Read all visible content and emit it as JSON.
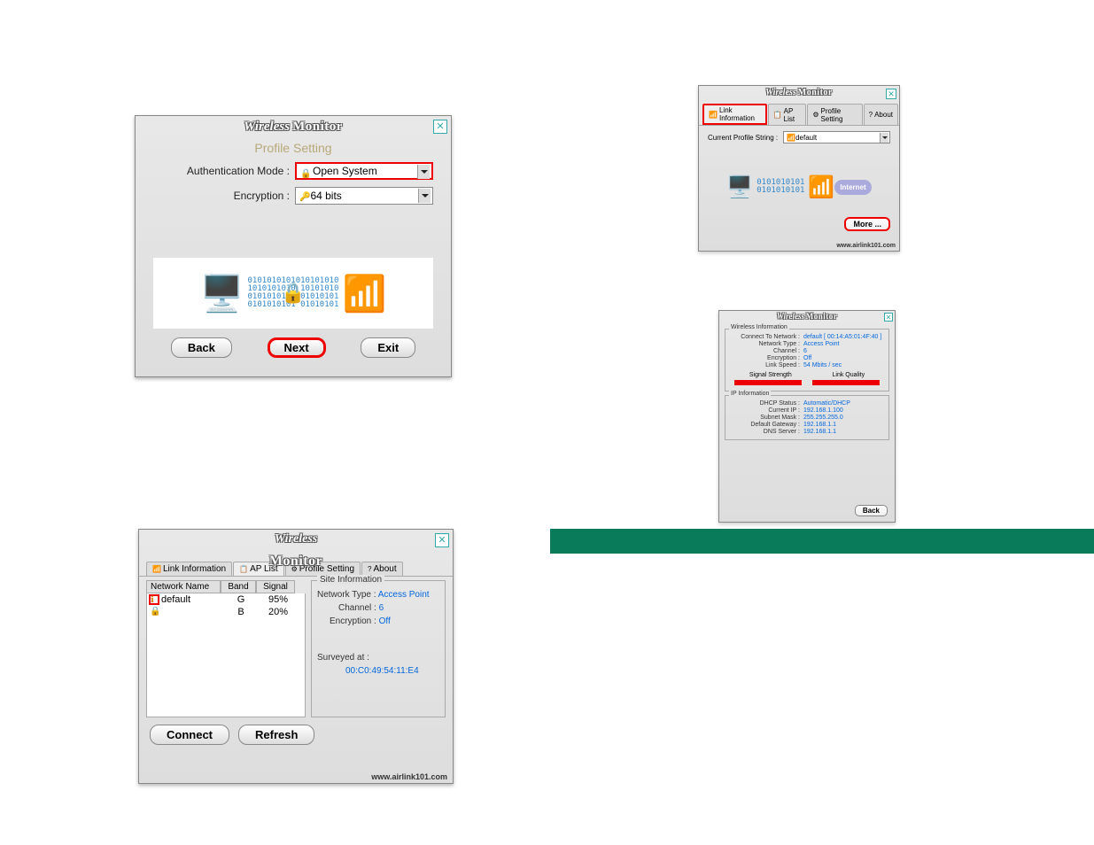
{
  "title_wireless": "Wireless",
  "title_monitor": "Monitor",
  "footer_url": "www.airlink101.com",
  "window1_profile": {
    "subtitle": "Profile Setting",
    "auth_label": "Authentication Mode :",
    "auth_value": "Open System",
    "enc_label": "Encryption :",
    "enc_value": "64 bits",
    "back": "Back",
    "next": "Next",
    "exit": "Exit"
  },
  "window2_linkinfo": {
    "tabs": {
      "link": "Link Information",
      "aplist": "AP List",
      "profile": "Profile Setting",
      "about": "About"
    },
    "profile_str_label": "Current Profile String :",
    "profile_str_value": "default",
    "internet": "Internet",
    "more": "More ..."
  },
  "window3_details": {
    "wireless_legend": "Wireless Information",
    "ip_legend": "IP Information",
    "rows": {
      "connect_to_lbl": "Connect To Network :",
      "connect_to_val": "default [ 00:14:A5:01:4F:40 ]",
      "nettype_lbl": "Network Type :",
      "nettype_val": "Access Point",
      "channel_lbl": "Channel :",
      "channel_val": "6",
      "enc_lbl": "Encryption :",
      "enc_val": "Off",
      "speed_lbl": "Link Speed :",
      "speed_val": "54 Mbits / sec",
      "sig_str": "Signal Strength",
      "link_q": "Link Quality",
      "dhcp_lbl": "DHCP Status :",
      "dhcp_val": "Automatic/DHCP",
      "curip_lbl": "Current IP :",
      "curip_val": "192.168.1.100",
      "mask_lbl": "Subnet Mask :",
      "mask_val": "255.255.255.0",
      "gw_lbl": "Default Gateway :",
      "gw_val": "192.168.1.1",
      "dns_lbl": "DNS Server :",
      "dns_val": "192.168.1.1"
    },
    "back": "Back"
  },
  "window4_aplist": {
    "tabs": {
      "link": "Link Information",
      "aplist": "AP List",
      "profile": "Profile Setting",
      "about": "About"
    },
    "headers": {
      "name": "Network Name",
      "band": "Band",
      "signal": "Signal"
    },
    "rows": [
      {
        "name": "default",
        "band": "G",
        "signal": "95%"
      },
      {
        "name": "",
        "band": "B",
        "signal": "20%"
      }
    ],
    "site_legend": "Site Information",
    "site": {
      "nettype_lbl": "Network Type :",
      "nettype_val": "Access Point",
      "channel_lbl": "Channel :",
      "channel_val": "6",
      "enc_lbl": "Encryption :",
      "enc_val": "Off",
      "survey_lbl": "Surveyed at :",
      "survey_val": "00:C0:49:54:11:E4"
    },
    "connect": "Connect",
    "refresh": "Refresh"
  }
}
